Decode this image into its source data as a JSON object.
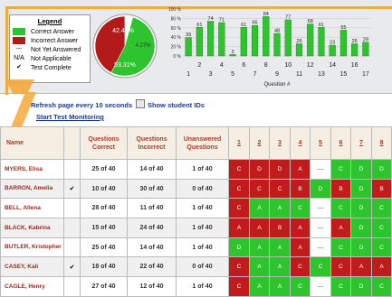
{
  "legend": {
    "title": "Legend",
    "items": [
      {
        "label": "Correct Answer",
        "color": "#2ec42e",
        "symbol": ""
      },
      {
        "label": "Incorrect Answer",
        "color": "#b31b1b",
        "symbol": ""
      },
      {
        "label": "Not Yet Answered",
        "color": "",
        "symbol": "---"
      },
      {
        "label": "Not Applicable",
        "color": "",
        "symbol": "N/A"
      },
      {
        "label": "Test Complete",
        "color": "",
        "symbol": "✔"
      }
    ]
  },
  "pie": {
    "correct_pct": "53.31%",
    "incorrect_pct": "42.42%",
    "other_pct": "4.27%",
    "correct": 53.31,
    "incorrect": 42.42,
    "other": 4.27
  },
  "chart_data": {
    "type": "bar",
    "xlabel": "Question #",
    "categories": [
      "1",
      "2",
      "3",
      "4",
      "5",
      "6",
      "7",
      "8",
      "9",
      "10",
      "11",
      "12",
      "13",
      "14",
      "15",
      "16",
      "17"
    ],
    "values": [
      39,
      61,
      74,
      71,
      3,
      61,
      65,
      84,
      48,
      77,
      26,
      68,
      61,
      23,
      55,
      26,
      29
    ],
    "y_ticks": [
      "100 %",
      "80 %",
      "60 %",
      "40 %",
      "20 %",
      "0 %"
    ],
    "x_tick_top": [
      "2",
      "4",
      "6",
      "8",
      "10",
      "12",
      "14",
      "16"
    ],
    "x_tick_bottom": [
      "1",
      "3",
      "5",
      "7",
      "9",
      "11",
      "13",
      "15",
      "17"
    ],
    "ylim": [
      0,
      100
    ]
  },
  "controls": {
    "refresh_label": "Refresh page every 10 seconds",
    "show_ids_label": "Show student IDs",
    "start_link": "Start Test Monitoring"
  },
  "table": {
    "headers": {
      "name": "Name",
      "correct": "Questions Correct",
      "incorrect": "Questions Incorrect",
      "unanswered": "Unanswered Questions",
      "questions": [
        "1",
        "2",
        "3",
        "4",
        "5",
        "6",
        "7",
        "8"
      ]
    },
    "rows": [
      {
        "name": "MYERS, Elisa",
        "complete": "",
        "correct": "25 of 40",
        "incorrect": "14 of 40",
        "unanswered": "1 of 40",
        "answers": [
          "C",
          "D",
          "D",
          "A",
          "---",
          "C",
          "D",
          "D"
        ],
        "colors": [
          "red",
          "red",
          "red",
          "red",
          "na",
          "green",
          "green",
          "green"
        ]
      },
      {
        "name": "BARRON, Amelia",
        "complete": "✔",
        "correct": "10 of 40",
        "incorrect": "30 of 40",
        "unanswered": "0 of 40",
        "answers": [
          "C",
          "C",
          "C",
          "B",
          "D",
          "B",
          "D",
          "B"
        ],
        "colors": [
          "red",
          "red",
          "red",
          "red",
          "green",
          "red",
          "green",
          "red"
        ]
      },
      {
        "name": "BELL, Allena",
        "complete": "",
        "correct": "28 of 40",
        "incorrect": "11 of 40",
        "unanswered": "1 of 40",
        "answers": [
          "C",
          "A",
          "A",
          "C",
          "---",
          "C",
          "D",
          "C"
        ],
        "colors": [
          "red",
          "green",
          "green",
          "green",
          "na",
          "green",
          "green",
          "green"
        ]
      },
      {
        "name": "BLACK, Kabrina",
        "complete": "",
        "correct": "15 of 40",
        "incorrect": "24 of 40",
        "unanswered": "1 of 40",
        "answers": [
          "A",
          "A",
          "B",
          "A",
          "---",
          "A",
          "D",
          "C"
        ],
        "colors": [
          "red",
          "red",
          "red",
          "red",
          "na",
          "red",
          "green",
          "green"
        ]
      },
      {
        "name": "BUTLER, Kristopher",
        "complete": "",
        "correct": "25 of 40",
        "incorrect": "14 of 40",
        "unanswered": "1 of 40",
        "answers": [
          "D",
          "A",
          "A",
          "A",
          "---",
          "C",
          "D",
          "C"
        ],
        "colors": [
          "green",
          "green",
          "green",
          "red",
          "na",
          "green",
          "green",
          "green"
        ]
      },
      {
        "name": "CASEY, Kali",
        "complete": "✔",
        "correct": "18 of 40",
        "incorrect": "22 of 40",
        "unanswered": "0 of 40",
        "answers": [
          "C",
          "A",
          "A",
          "C",
          "C",
          "C",
          "A",
          "A"
        ],
        "colors": [
          "red",
          "green",
          "green",
          "red",
          "green",
          "red",
          "red",
          "red"
        ]
      },
      {
        "name": "CAGLE, Henry",
        "complete": "",
        "correct": "27 of 40",
        "incorrect": "12 of 40",
        "unanswered": "1 of 40",
        "answers": [
          "C",
          "A",
          "A",
          "C",
          "---",
          "C",
          "D",
          "C"
        ],
        "colors": [
          "red",
          "green",
          "green",
          "green",
          "na",
          "green",
          "green",
          "green"
        ]
      }
    ]
  }
}
